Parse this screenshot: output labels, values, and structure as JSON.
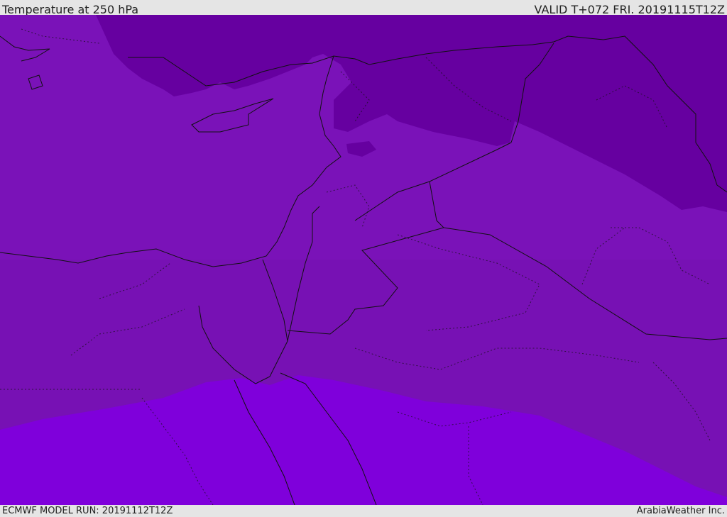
{
  "header": {
    "title": "Temperature at 250 hPa",
    "valid": "VALID T+072 FRI. 20191115T12Z"
  },
  "footer": {
    "model_run": "ECMWF MODEL RUN: 20191112T12Z",
    "credit": "ArabiaWeather Inc."
  },
  "map": {
    "colors": {
      "cold_band": "#6600a0",
      "mid_band": "#7a12b8",
      "warm_band": "#7f00db",
      "border": "#111111"
    }
  }
}
